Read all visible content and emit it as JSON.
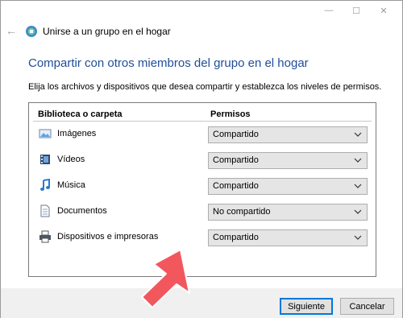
{
  "window": {
    "controls": {
      "minimize": "—",
      "maximize": "☐",
      "close": "✕"
    }
  },
  "nav": {
    "back_icon": "back-arrow-icon",
    "title": "Unirse a un grupo en el hogar"
  },
  "main": {
    "heading": "Compartir con otros miembros del grupo en el hogar",
    "subtitle": "Elija los archivos y dispositivos que desea compartir y establezca los niveles de permisos.",
    "columns": {
      "library": "Biblioteca o carpeta",
      "permissions": "Permisos"
    },
    "rows": [
      {
        "label": "Imágenes",
        "icon": "pictures-icon",
        "value": "Compartido"
      },
      {
        "label": "Vídeos",
        "icon": "videos-icon",
        "value": "Compartido"
      },
      {
        "label": "Música",
        "icon": "music-icon",
        "value": "Compartido"
      },
      {
        "label": "Documentos",
        "icon": "documents-icon",
        "value": "No compartido"
      },
      {
        "label": "Dispositivos e impresoras",
        "icon": "printer-icon",
        "value": "Compartido"
      }
    ]
  },
  "footer": {
    "next_label": "Siguiente",
    "cancel_label": "Cancelar"
  },
  "colors": {
    "accent": "#0078d7",
    "heading": "#1f4e99",
    "arrow": "#f2575d"
  }
}
